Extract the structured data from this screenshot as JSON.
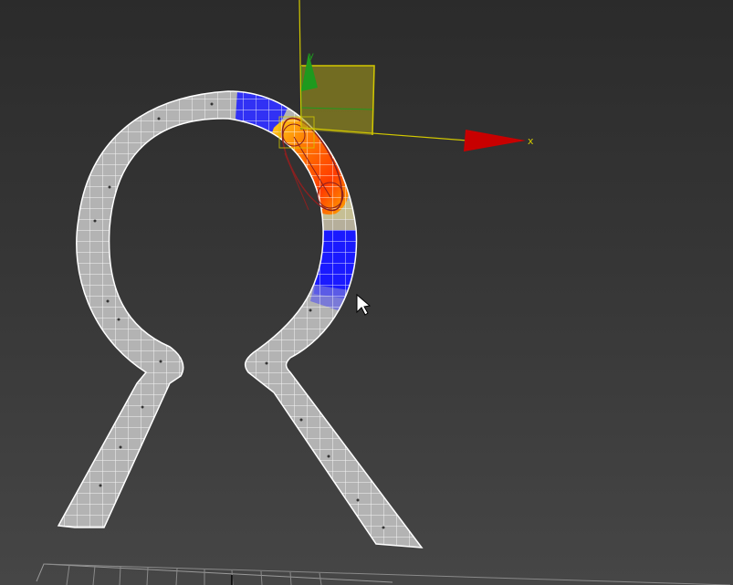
{
  "viewport": {
    "axis_label_x": "x",
    "axis_label_y": "y",
    "colors": {
      "background_top": "#2b2b2b",
      "background_bottom": "#464646",
      "mesh_fill": "#b0b0b0",
      "mesh_wire": "#ffffff",
      "soft_selection_far": "#1a1aff",
      "soft_selection_mid": "#ffd21f",
      "soft_selection_core": "#ff3c00",
      "gizmo_x": "#c80000",
      "gizmo_y": "#1e9a1e",
      "gizmo_plane": "#d2c800"
    },
    "icons": {
      "cursor": "arrow-pointer-icon",
      "move_gizmo": "move-transform-gizmo-icon"
    }
  }
}
